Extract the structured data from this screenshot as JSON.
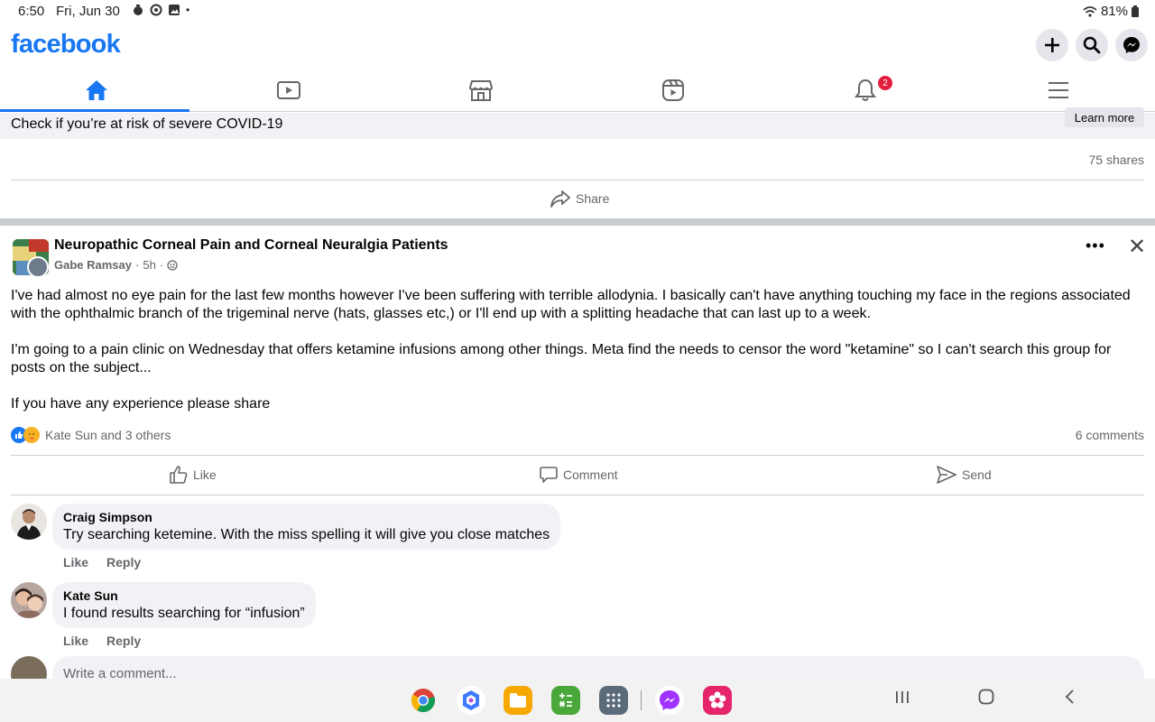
{
  "status": {
    "time": "6:50",
    "date": "Fri, Jun 30",
    "dot": "•",
    "battery": "81%"
  },
  "app": {
    "logo": "facebook"
  },
  "nav": {
    "notifications_badge": "2"
  },
  "prev_post": {
    "title": "Check if you’re at risk of severe COVID-19",
    "learn_more": "Learn more",
    "shares": "75 shares",
    "share_label": "Share"
  },
  "post": {
    "group_name": "Neuropathic Corneal Pain and Corneal Neuralgia Patients",
    "author": "Gabe Ramsay",
    "time": "5h",
    "more": "•••",
    "close": "✕",
    "paragraphs": [
      "I've had almost no eye pain for the last few months however I've been suffering with terrible allodynia. I basically can't have anything touching my face in the regions associated with the ophthalmic branch of the trigeminal nerve (hats, glasses etc,) or I'll end up with a splitting headache that can last up to a week.",
      "I'm going to a pain clinic on Wednesday that offers ketamine infusions among other things. Meta find the needs to censor the word \"ketamine\" so I can't search this group for posts on the subject...",
      "If you have any experience please share"
    ],
    "reactions_text": "Kate Sun and 3 others",
    "comments_count": "6 comments",
    "like_label": "Like",
    "comment_label": "Comment",
    "send_label": "Send"
  },
  "comments": [
    {
      "name": "Craig Simpson",
      "text": "Try searching ketemine. With the miss spelling it will give you close matches",
      "like": "Like",
      "reply": "Reply"
    },
    {
      "name": "Kate Sun",
      "text": "I found results searching for “infusion”",
      "like": "Like",
      "reply": "Reply"
    }
  ],
  "composer": {
    "placeholder": "Write a comment..."
  },
  "colors": {
    "brand": "#1877f2",
    "badge": "#e41e3f"
  }
}
